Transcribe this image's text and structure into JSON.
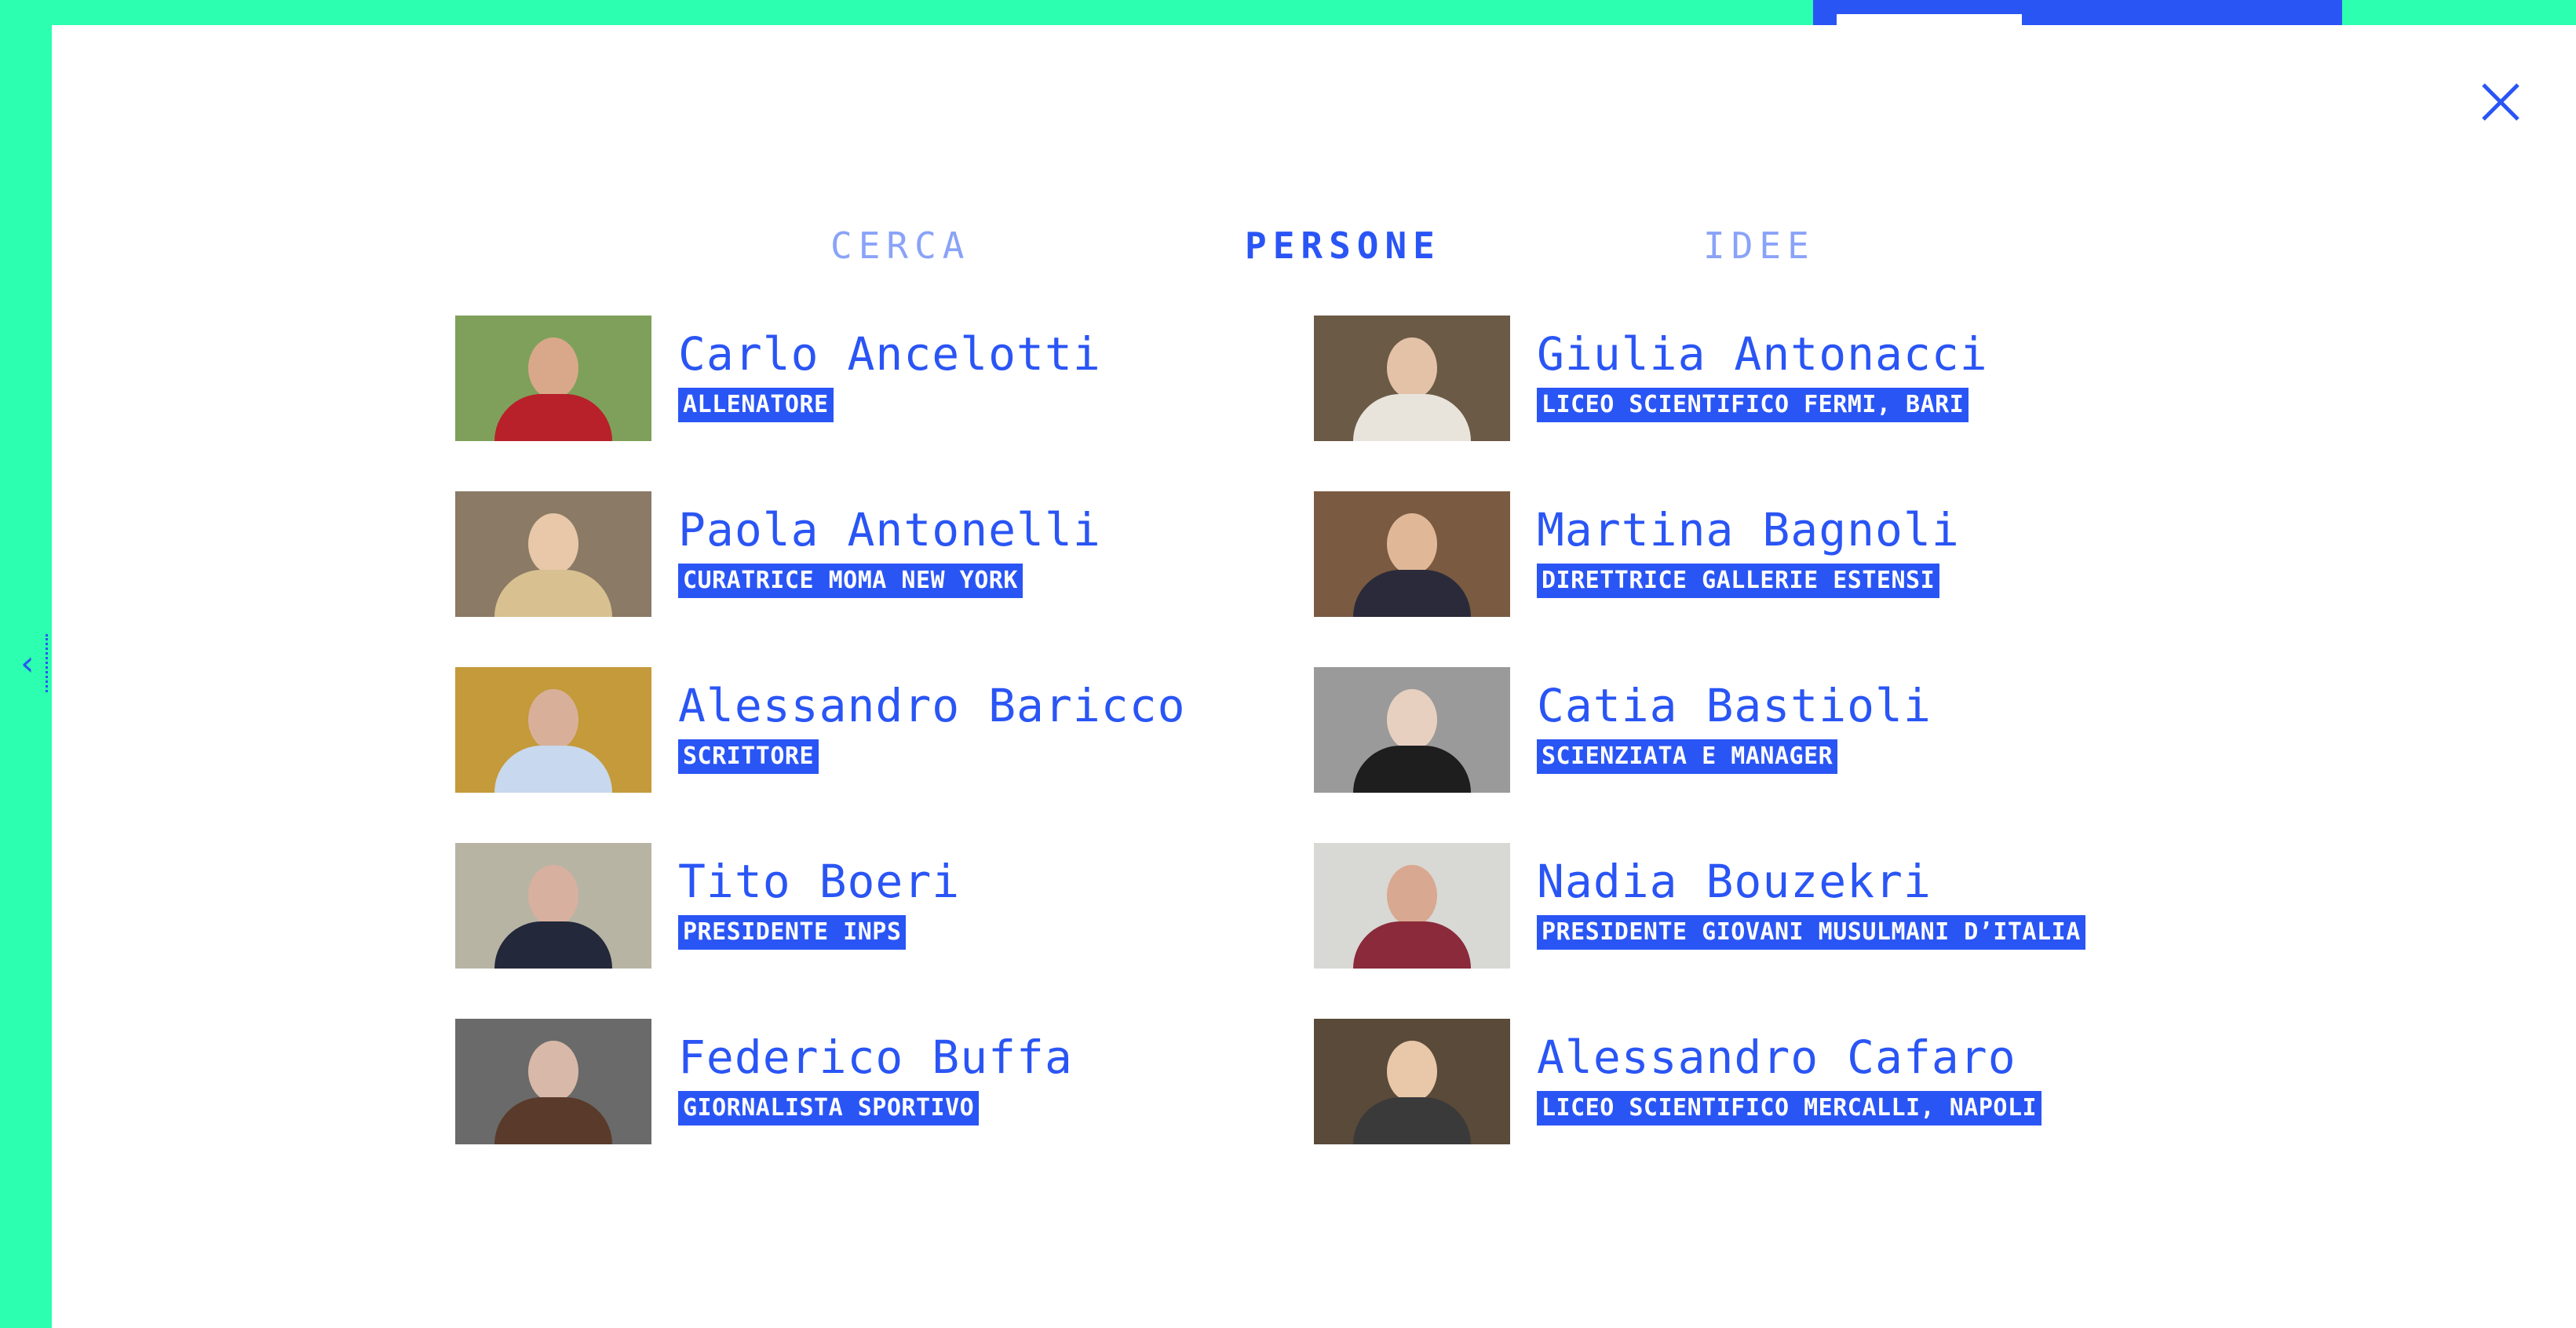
{
  "background": {
    "accent": "#2dffb0",
    "brand": "#2a55f5",
    "tag_label": "GIORNALISTA"
  },
  "modal": {
    "close_icon": "close-icon"
  },
  "tabs": [
    {
      "label": "CERCA",
      "active": false
    },
    {
      "label": "PERSONE",
      "active": true
    },
    {
      "label": "IDEE",
      "active": false
    }
  ],
  "people": [
    {
      "name": "Carlo Ancelotti",
      "role": "ALLENATORE",
      "thumb": {
        "bg": "#7fa05a",
        "skin": "#d9a88a",
        "shirt": "#b8202a"
      }
    },
    {
      "name": "Giulia Antonacci",
      "role": "LICEO SCIENTIFICO FERMI, BARI",
      "thumb": {
        "bg": "#6b5a45",
        "skin": "#e3c2a8",
        "shirt": "#e8e4dc"
      }
    },
    {
      "name": "Paola Antonelli",
      "role": "CURATRICE MOMA NEW YORK",
      "thumb": {
        "bg": "#8a7a66",
        "skin": "#e8c8a8",
        "shirt": "#d8c090"
      }
    },
    {
      "name": "Martina Bagnoli",
      "role": "DIRETTRICE GALLERIE ESTENSI",
      "thumb": {
        "bg": "#7a5a40",
        "skin": "#e0b898",
        "shirt": "#2a2a3a"
      }
    },
    {
      "name": "Alessandro Baricco",
      "role": "SCRITTORE",
      "thumb": {
        "bg": "#c49a3a",
        "skin": "#d8b09a",
        "shirt": "#c8d8ee"
      }
    },
    {
      "name": "Catia Bastioli",
      "role": "SCIENZIATA E MANAGER",
      "thumb": {
        "bg": "#9a9a9a",
        "skin": "#e8d0c0",
        "shirt": "#1e1e1e"
      }
    },
    {
      "name": "Tito Boeri",
      "role": "PRESIDENTE INPS",
      "thumb": {
        "bg": "#b8b4a4",
        "skin": "#d8b0a0",
        "shirt": "#23283a"
      }
    },
    {
      "name": "Nadia Bouzekri",
      "role": "PRESIDENTE GIOVANI MUSULMANI D’ITALIA",
      "thumb": {
        "bg": "#d8d8d4",
        "skin": "#d8a890",
        "shirt": "#8a2a3a"
      }
    },
    {
      "name": "Federico Buffa",
      "role": "GIORNALISTA SPORTIVO",
      "thumb": {
        "bg": "#6a6a6a",
        "skin": "#d8b8a8",
        "shirt": "#5a3a2a"
      }
    },
    {
      "name": "Alessandro Cafaro",
      "role": "LICEO SCIENTIFICO MERCALLI, NAPOLI",
      "thumb": {
        "bg": "#5a4a3a",
        "skin": "#e8c8a8",
        "shirt": "#3a3a3a"
      }
    }
  ]
}
